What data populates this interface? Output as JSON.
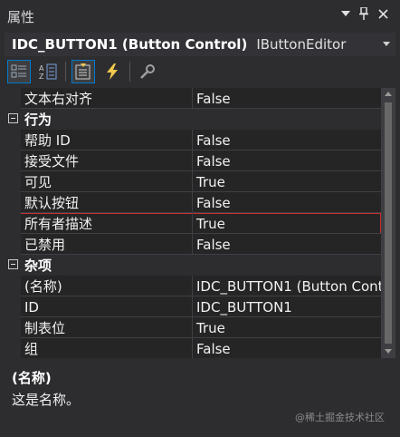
{
  "window": {
    "title": "属性"
  },
  "selector": {
    "object_name": "IDC_BUTTON1 (Button Control)",
    "object_type": "IButtonEditor"
  },
  "toolbar": {
    "icons": [
      "categorized-icon",
      "alphabetical-icon",
      "properties-icon",
      "events-icon",
      "property-pages-icon"
    ]
  },
  "grid": {
    "rows": [
      {
        "kind": "prop",
        "name": "文本右对齐",
        "value": "False"
      },
      {
        "kind": "cat",
        "name": "行为"
      },
      {
        "kind": "prop",
        "name": "帮助 ID",
        "value": "False"
      },
      {
        "kind": "prop",
        "name": "接受文件",
        "value": "False"
      },
      {
        "kind": "prop",
        "name": "可见",
        "value": "True"
      },
      {
        "kind": "prop",
        "name": "默认按钮",
        "value": "False"
      },
      {
        "kind": "prop",
        "name": "所有者描述",
        "value": "True",
        "selected": true
      },
      {
        "kind": "prop",
        "name": "已禁用",
        "value": "False"
      },
      {
        "kind": "cat",
        "name": "杂项"
      },
      {
        "kind": "prop",
        "name": "(名称)",
        "value": "IDC_BUTTON1 (Button Cont"
      },
      {
        "kind": "prop",
        "name": "ID",
        "value": "IDC_BUTTON1"
      },
      {
        "kind": "prop",
        "name": "制表位",
        "value": "True"
      },
      {
        "kind": "prop",
        "name": "组",
        "value": "False"
      }
    ]
  },
  "description": {
    "title": "(名称)",
    "text": "这是名称。"
  },
  "watermark": "@稀土掘金技术社区",
  "colors": {
    "selection_outline": "#c8302d",
    "accent": "#007acc"
  }
}
